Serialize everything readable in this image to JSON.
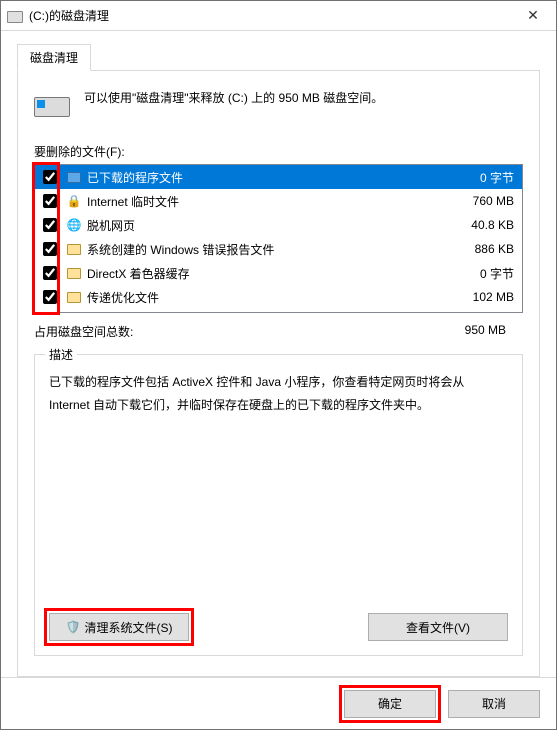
{
  "window": {
    "title": "(C:)的磁盘清理"
  },
  "tabs": {
    "cleanup": "磁盘清理"
  },
  "intro": "可以使用\"磁盘清理\"来释放  (C:) 上的 950 MB 磁盘空间。",
  "filesToDeleteLabel": "要删除的文件(F):",
  "items": [
    {
      "checked": true,
      "icon": "folder-sel",
      "label": "已下载的程序文件",
      "size": "0 字节",
      "selected": true
    },
    {
      "checked": true,
      "icon": "lock",
      "label": "Internet 临时文件",
      "size": "760 MB"
    },
    {
      "checked": true,
      "icon": "globe",
      "label": "脱机网页",
      "size": "40.8 KB"
    },
    {
      "checked": true,
      "icon": "folder",
      "label": "系统创建的 Windows 错误报告文件",
      "size": "886 KB"
    },
    {
      "checked": true,
      "icon": "folder",
      "label": "DirectX 着色器缓存",
      "size": "0 字节"
    },
    {
      "checked": true,
      "icon": "folder",
      "label": "传递优化文件",
      "size": "102 MB"
    }
  ],
  "total": {
    "label": "占用磁盘空间总数:",
    "value": "950 MB"
  },
  "desc": {
    "legend": "描述",
    "body": "已下载的程序文件包括 ActiveX 控件和 Java 小程序，你查看特定网页时将会从 Internet 自动下载它们，并临时保存在硬盘上的已下载的程序文件夹中。"
  },
  "buttons": {
    "cleanSystem": "清理系统文件(S)",
    "viewFiles": "查看文件(V)",
    "ok": "确定",
    "cancel": "取消"
  }
}
